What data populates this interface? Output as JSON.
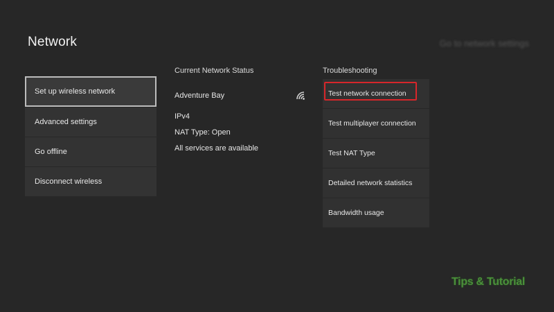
{
  "header": {
    "title": "Network",
    "top_right_blurred": "Go to network settings"
  },
  "left_menu": {
    "items": [
      {
        "label": "Set up wireless network",
        "selected": true
      },
      {
        "label": "Advanced settings"
      },
      {
        "label": "Go offline"
      },
      {
        "label": "Disconnect wireless"
      }
    ]
  },
  "status": {
    "header": "Current Network Status",
    "network_name": "Adventure Bay",
    "network_icon": "wifi-icon",
    "ip_version": "IPv4",
    "nat_type": "NAT Type: Open",
    "services": "All services are available"
  },
  "troubleshooting": {
    "header": "Troubleshooting",
    "items": [
      {
        "label": "Test network connection",
        "highlighted": true
      },
      {
        "label": "Test multiplayer connection"
      },
      {
        "label": "Test NAT Type"
      },
      {
        "label": "Detailed network statistics"
      },
      {
        "label": "Bandwidth usage"
      }
    ],
    "highlight_color": "#d8262a"
  },
  "watermark": {
    "text": "Tips & Tutorial"
  }
}
